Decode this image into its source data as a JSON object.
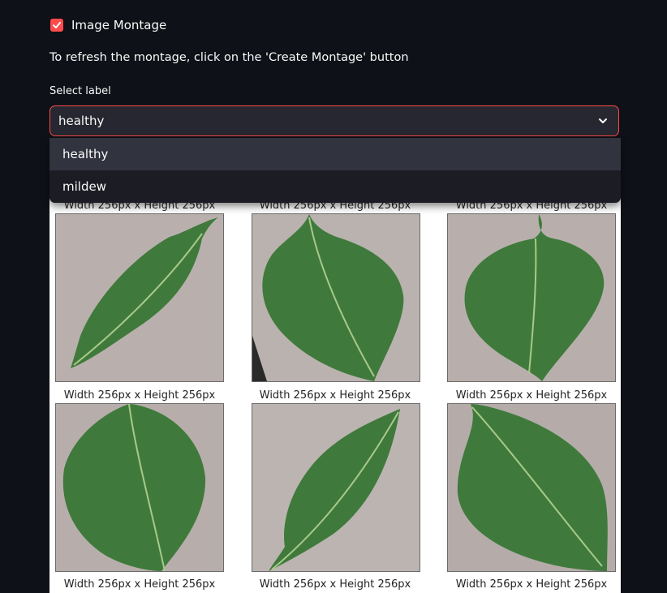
{
  "checkbox": {
    "label": "Image Montage",
    "checked": true
  },
  "info_text": "To refresh the montage, click on the 'Create Montage' button",
  "select": {
    "label": "Select label",
    "value": "healthy",
    "options": [
      "healthy",
      "mildew"
    ]
  },
  "montage": {
    "captions": [
      "Width 256px x Height 256px",
      "Width 256px x Height 256px",
      "Width 256px x Height 256px",
      "Width 256px x Height 256px",
      "Width 256px x Height 256px",
      "Width 256px x Height 256px",
      "Width 256px x Height 256px",
      "Width 256px x Height 256px",
      "Width 256px x Height 256px"
    ]
  },
  "colors": {
    "accent": "#ff4b4b",
    "background": "#0e1117",
    "select_bg": "#262730",
    "leaf": "#3f7a3c"
  }
}
